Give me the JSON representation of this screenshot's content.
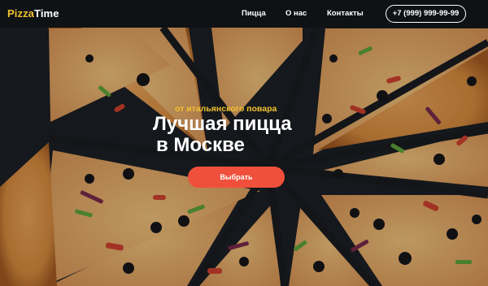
{
  "brand": {
    "logo_part1": "Pizza",
    "logo_part2": "Time"
  },
  "nav": {
    "items": [
      {
        "label": "Пицца"
      },
      {
        "label": "О нас"
      },
      {
        "label": "Контакты"
      }
    ]
  },
  "contact": {
    "phone": "+7 (999) 999-99-99"
  },
  "hero": {
    "subtitle": "от итальянского повара",
    "title_line1": "Лучшая пицца",
    "title_line2": "в Москве",
    "cta_label": "Выбрать",
    "background": "pizza-photo"
  },
  "colors": {
    "accent": "#f0503b",
    "brand_yellow": "#f2c230",
    "header_bg": "#0f1114",
    "text": "#ffffff"
  }
}
